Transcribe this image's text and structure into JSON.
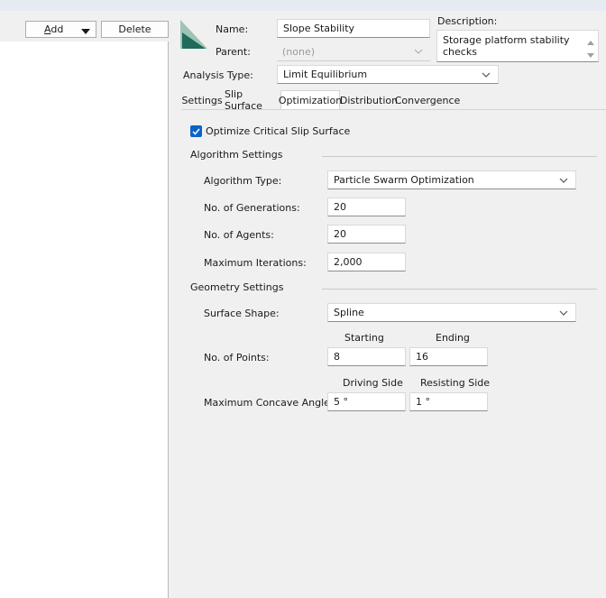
{
  "toolbar": {
    "add_label_prefix": "",
    "add_label_underlined": "A",
    "add_label_rest": "dd",
    "delete_label": "Delete"
  },
  "header": {
    "name_label": "Name:",
    "name_value": "Slope Stability",
    "parent_label": "Parent:",
    "parent_value": "(none)",
    "description_label": "Description:",
    "description_value": "Storage platform stability checks",
    "analysis_type_label": "Analysis Type:",
    "analysis_type_value": "Limit Equilibrium"
  },
  "tabs": [
    {
      "label": "Settings",
      "active": false
    },
    {
      "label": "Slip Surface",
      "active": false
    },
    {
      "label": "Optimization",
      "active": true
    },
    {
      "label": "Distribution",
      "active": false
    },
    {
      "label": "Convergence",
      "active": false
    }
  ],
  "optimization": {
    "optimize_checkbox_label": "Optimize Critical Slip Surface",
    "optimize_checked": true,
    "algorithm_section": "Algorithm Settings",
    "algorithm_type_label": "Algorithm Type:",
    "algorithm_type_value": "Particle Swarm Optimization",
    "generations_label": "No. of Generations:",
    "generations_value": "20",
    "agents_label": "No. of Agents:",
    "agents_value": "20",
    "max_iterations_label": "Maximum Iterations:",
    "max_iterations_value": "2,000",
    "geometry_section": "Geometry Settings",
    "surface_shape_label": "Surface Shape:",
    "surface_shape_value": "Spline",
    "starting_header": "Starting",
    "ending_header": "Ending",
    "points_label": "No. of Points:",
    "points_start_value": "8",
    "points_end_value": "16",
    "driving_side_header": "Driving Side",
    "resisting_side_header": "Resisting Side",
    "concave_angle_label": "Maximum Concave Angle:",
    "driving_side_value": "5 °",
    "resisting_side_value": "1 °"
  },
  "colors": {
    "accent": "#0a64c8",
    "icon_light": "#9fc3b3",
    "icon_dark": "#1f6b5c"
  }
}
